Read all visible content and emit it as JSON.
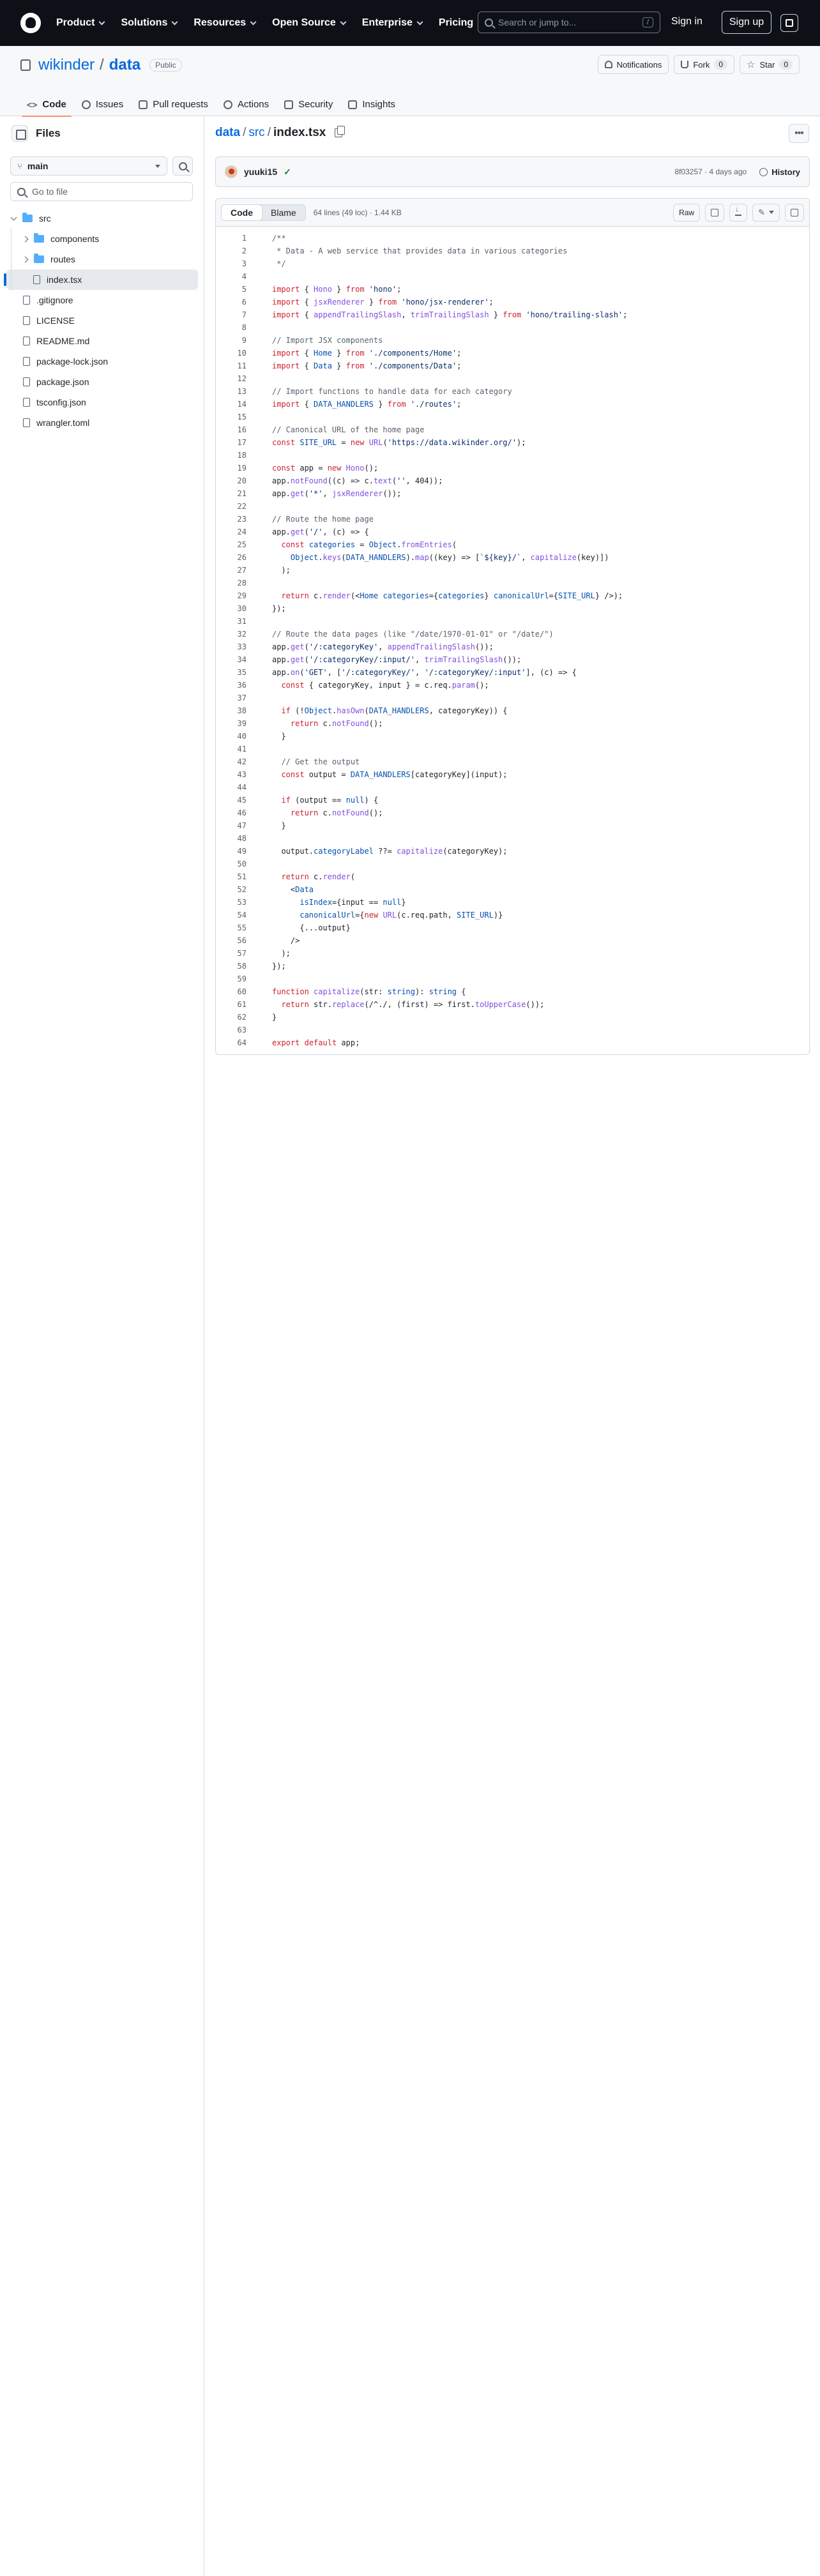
{
  "header": {
    "nav": [
      "Product",
      "Solutions",
      "Resources",
      "Open Source",
      "Enterprise",
      "Pricing"
    ],
    "search_placeholder": "Search or jump to...",
    "search_key": "/",
    "signin": "Sign in",
    "signup": "Sign up"
  },
  "repo": {
    "owner": "wikinder",
    "name": "data",
    "visibility": "Public",
    "notifications": "Notifications",
    "fork_label": "Fork",
    "fork_count": "0",
    "star_label": "Star",
    "star_count": "0",
    "tabs": [
      {
        "label": "Code",
        "icon": "code-icon",
        "active": true
      },
      {
        "label": "Issues",
        "icon": "issue-icon"
      },
      {
        "label": "Pull requests",
        "icon": "pull-request-icon"
      },
      {
        "label": "Actions",
        "icon": "play-icon"
      },
      {
        "label": "Security",
        "icon": "shield-icon"
      },
      {
        "label": "Insights",
        "icon": "graph-icon"
      }
    ]
  },
  "sidebar": {
    "title": "Files",
    "branch": "main",
    "goto_placeholder": "Go to file",
    "tree": {
      "root": "src",
      "items": [
        {
          "label": "components",
          "type": "folder"
        },
        {
          "label": "routes",
          "type": "folder"
        },
        {
          "label": "index.tsx",
          "type": "file",
          "selected": true
        }
      ],
      "root_files": [
        ".gitignore",
        "LICENSE",
        "README.md",
        "package-lock.json",
        "package.json",
        "tsconfig.json",
        "wrangler.toml"
      ]
    }
  },
  "breadcrumb": {
    "repo": "data",
    "dir": "src",
    "file": "index.tsx"
  },
  "commit": {
    "author": "yuuki15",
    "meta": "8f03257 · 4 days ago",
    "history": "History"
  },
  "file": {
    "view_code": "Code",
    "view_blame": "Blame",
    "info": "64 lines (49 loc) · 1.44 KB",
    "raw": "Raw"
  },
  "colors": {
    "header_bg": "#0d1117",
    "link": "#0969da",
    "keyword": "#cf222e",
    "string": "#0a3069",
    "comment": "#59636e",
    "function": "#8250df",
    "constant": "#0550ae",
    "tag": "#116329",
    "active_tab_underline": "#fd8c73"
  },
  "code_lines": [
    "/**",
    " * Data - A web service that provides data in various categories",
    " */",
    "",
    "import { Hono } from 'hono';",
    "import { jsxRenderer } from 'hono/jsx-renderer';",
    "import { appendTrailingSlash, trimTrailingSlash } from 'hono/trailing-slash';",
    "",
    "// Import JSX components",
    "import { Home } from './components/Home';",
    "import { Data } from './components/Data';",
    "",
    "// Import functions to handle data for each category",
    "import { DATA_HANDLERS } from './routes';",
    "",
    "// Canonical URL of the home page",
    "const SITE_URL = new URL('https://data.wikinder.org/');",
    "",
    "const app = new Hono();",
    "app.notFound((c) => c.text('', 404));",
    "app.get('*', jsxRenderer());",
    "",
    "// Route the home page",
    "app.get('/', (c) => {",
    "  const categories = Object.fromEntries(",
    "    Object.keys(DATA_HANDLERS).map((key) => [`${key}/`, capitalize(key)])",
    "  );",
    "",
    "  return c.render(<Home categories={categories} canonicalUrl={SITE_URL} />);",
    "});",
    "",
    "// Route the data pages (like \"/date/1970-01-01\" or \"/date/\")",
    "app.get('/:categoryKey', appendTrailingSlash());",
    "app.get('/:categoryKey/:input/', trimTrailingSlash());",
    "app.on('GET', ['/:categoryKey/', '/:categoryKey/:input'], (c) => {",
    "  const { categoryKey, input } = c.req.param();",
    "",
    "  if (!Object.hasOwn(DATA_HANDLERS, categoryKey)) {",
    "    return c.notFound();",
    "  }",
    "",
    "  // Get the output",
    "  const output = DATA_HANDLERS[categoryKey](input);",
    "",
    "  if (output == null) {",
    "    return c.notFound();",
    "  }",
    "",
    "  output.categoryLabel ??= capitalize(categoryKey);",
    "",
    "  return c.render(",
    "    <Data",
    "      isIndex={input == null}",
    "      canonicalUrl={new URL(c.req.path, SITE_URL)}",
    "      {...output}",
    "    />",
    "  );",
    "});",
    "",
    "function capitalize(str: string): string {",
    "  return str.replace(/^./, (first) => first.toUpperCase());",
    "}",
    "",
    "export default app;"
  ]
}
